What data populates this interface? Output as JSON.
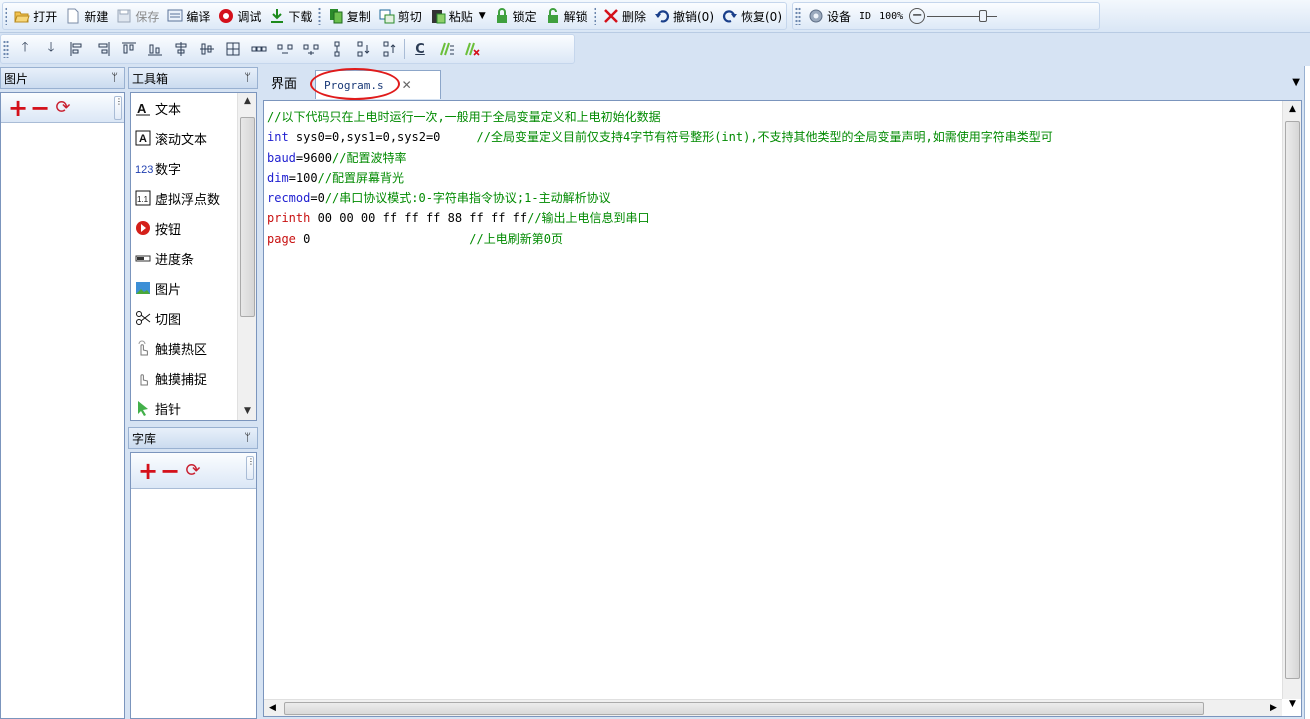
{
  "toolbar_main": {
    "open": "打开",
    "new": "新建",
    "save": "保存",
    "compile": "编译",
    "debug": "调试",
    "download": "下载",
    "copy": "复制",
    "cut": "剪切",
    "paste": "粘贴",
    "lock": "锁定",
    "unlock": "解锁",
    "delete": "删除",
    "undo": "撤销(0)",
    "redo": "恢复(0)",
    "device": "设备",
    "id": "ID",
    "zoom": "100%"
  },
  "toolbar_align": {
    "c_label": "C"
  },
  "panels": {
    "pictures_title": "图片",
    "toolbox_title": "工具箱",
    "fonts_title": "字库",
    "pin": "ᛘ"
  },
  "toolbox": {
    "items": [
      {
        "label": "文本",
        "icon": "text-icon"
      },
      {
        "label": "滚动文本",
        "icon": "scroll-text-icon"
      },
      {
        "label": "数字",
        "icon": "number-icon"
      },
      {
        "label": "虚拟浮点数",
        "icon": "float-icon"
      },
      {
        "label": "按钮",
        "icon": "button-icon"
      },
      {
        "label": "进度条",
        "icon": "progress-icon"
      },
      {
        "label": "图片",
        "icon": "picture-icon"
      },
      {
        "label": "切图",
        "icon": "crop-icon"
      },
      {
        "label": "触摸热区",
        "icon": "touch-area-icon"
      },
      {
        "label": "触摸捕捉",
        "icon": "touch-capture-icon"
      },
      {
        "label": "指针",
        "icon": "pointer-icon"
      }
    ]
  },
  "tabs": {
    "ui": "界面",
    "program": "Program.s"
  },
  "code": {
    "l1": "//以下代码只在上电时运行一次,一般用于全局变量定义和上电初始化数据",
    "l2_kw": "int",
    "l2_rest": " sys0=0,sys1=0,sys2=0     ",
    "l2_cm": "//全局变量定义目前仅支持4字节有符号整形(int),不支持其他类型的全局变量声明,如需使用字符串类型可",
    "l3_kw": "baud",
    "l3_rest": "=9600",
    "l3_cm": "//配置波特率",
    "l4_kw": "dim",
    "l4_rest": "=100",
    "l4_cm": "//配置屏幕背光",
    "l5_kw": "recmod",
    "l5_rest": "=0",
    "l5_cm": "//串口协议模式:0-字符串指令协议;1-主动解析协议",
    "l6_kw": "printh",
    "l6_rest": " 00 00 00 ff ff ff 88 ff ff ff",
    "l6_cm": "//输出上电信息到串口",
    "l7_kw": "page",
    "l7_rest": " 0                      ",
    "l7_cm": "//上电刷新第0页"
  }
}
